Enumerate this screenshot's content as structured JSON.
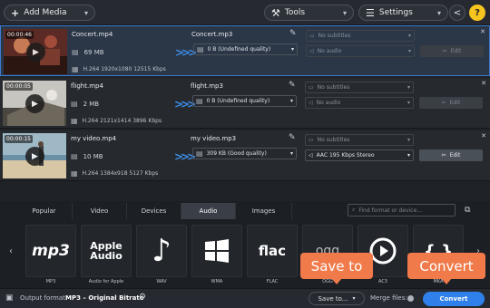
{
  "toolbar": {
    "add_media": "Add Media",
    "tools": "Tools",
    "settings": "Settings"
  },
  "files": [
    {
      "duration": "00:00:46",
      "name": "Concert.mp4",
      "size": "69 MB",
      "codec": "H.264 1920x1080 12515 Kbps",
      "output_name": "Concert.mp3",
      "output_size": "0 B (Undefined quality)",
      "subtitles": "No subtitles",
      "audio": "No audio",
      "edit": "Edit",
      "selected": true
    },
    {
      "duration": "00:00:05",
      "name": "flight.mp4",
      "size": "2 MB",
      "codec": "H.264 2121x1414 3896 Kbps",
      "output_name": "flight.mp3",
      "output_size": "0 B (Undefined quality)",
      "subtitles": "No subtitles",
      "audio": "No audio",
      "edit": "Edit",
      "selected": false
    },
    {
      "duration": "00:00:15",
      "name": "my video.mp4",
      "size": "10 MB",
      "codec": "H.264 1384x918 5127 Kbps",
      "output_name": "my video.mp3",
      "output_size": "309 KB (Good quality)",
      "subtitles": "No subtitles",
      "audio": "AAC 195 Kbps Stereo",
      "edit": "Edit",
      "selected": false
    }
  ],
  "tabs": [
    "Popular",
    "Video",
    "Devices",
    "Audio",
    "Images"
  ],
  "active_tab": "Audio",
  "search_placeholder": "Find format or device...",
  "formats": [
    {
      "label": "MP3",
      "icon": "mp3-logo-icon",
      "text": "mp3"
    },
    {
      "label": "Audio for Apple",
      "icon": "apple-audio-icon",
      "text": "Apple Audio"
    },
    {
      "label": "WAV",
      "icon": "music-note-icon",
      "text": "♪"
    },
    {
      "label": "WMA",
      "icon": "windows-logo-icon",
      "text": ""
    },
    {
      "label": "FLAC",
      "icon": "flac-logo-icon",
      "text": "flac"
    },
    {
      "label": "OGG",
      "icon": "ogg-icon",
      "text": "ogg"
    },
    {
      "label": "AC3",
      "icon": "play-circle-icon",
      "text": ""
    },
    {
      "label": "MKA",
      "icon": "mka-braces-icon",
      "text": "{ }"
    }
  ],
  "footer": {
    "output_format_label": "Output format:",
    "output_format_value": "MP3 – Original Bitrate",
    "save_to": "Save to...",
    "merge_files": "Merge files:",
    "convert": "Convert"
  },
  "callouts": {
    "save_to": "Save to",
    "convert": "Convert"
  },
  "colors": {
    "accent": "#3d8ee8",
    "convert": "#2f80ea",
    "callout": "#f07a4a",
    "help": "#f6c51e"
  }
}
